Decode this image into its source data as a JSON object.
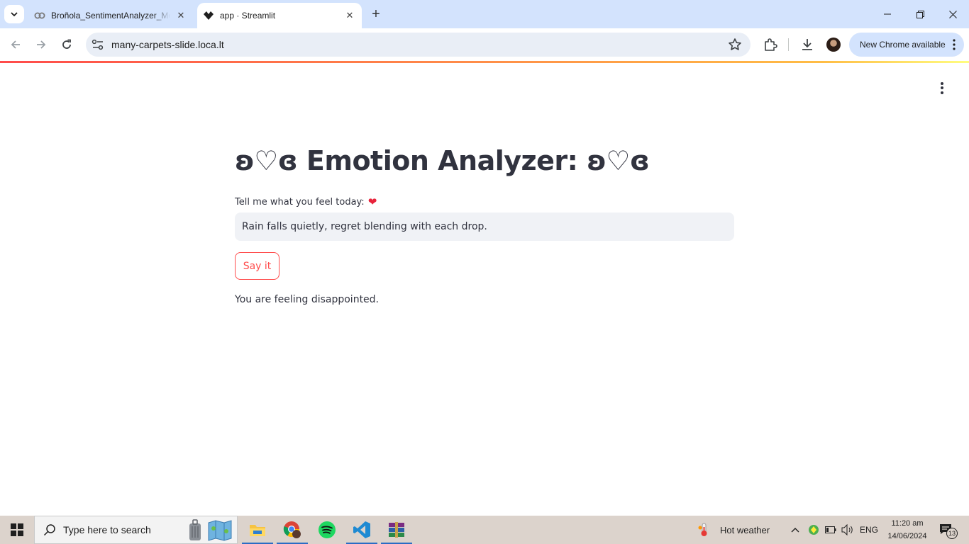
{
  "browser": {
    "tabs": [
      {
        "title": "Broñola_SentimentAnalyzer_Mo",
        "icon": "colab-icon"
      },
      {
        "title": "app · Streamlit",
        "icon": "streamlit-icon",
        "active": true
      }
    ],
    "url": "many-carpets-slide.loca.lt",
    "update_label": "New Chrome available"
  },
  "app": {
    "title": "ʚ♡ɞ Emotion Analyzer: ʚ♡ɞ",
    "input_label": "Tell me what you feel today:",
    "input_label_emoji": "❤",
    "input_value": "Rain falls quietly, regret blending with each drop.",
    "button_label": "Say it",
    "result": "You are feeling disappointed.",
    "accent_color": "#ff4b4b"
  },
  "taskbar": {
    "search_placeholder": "Type here to search",
    "weather": "Hot weather",
    "language": "ENG",
    "time": "11:20 am",
    "date": "14/06/2024",
    "notification_count": "13"
  }
}
